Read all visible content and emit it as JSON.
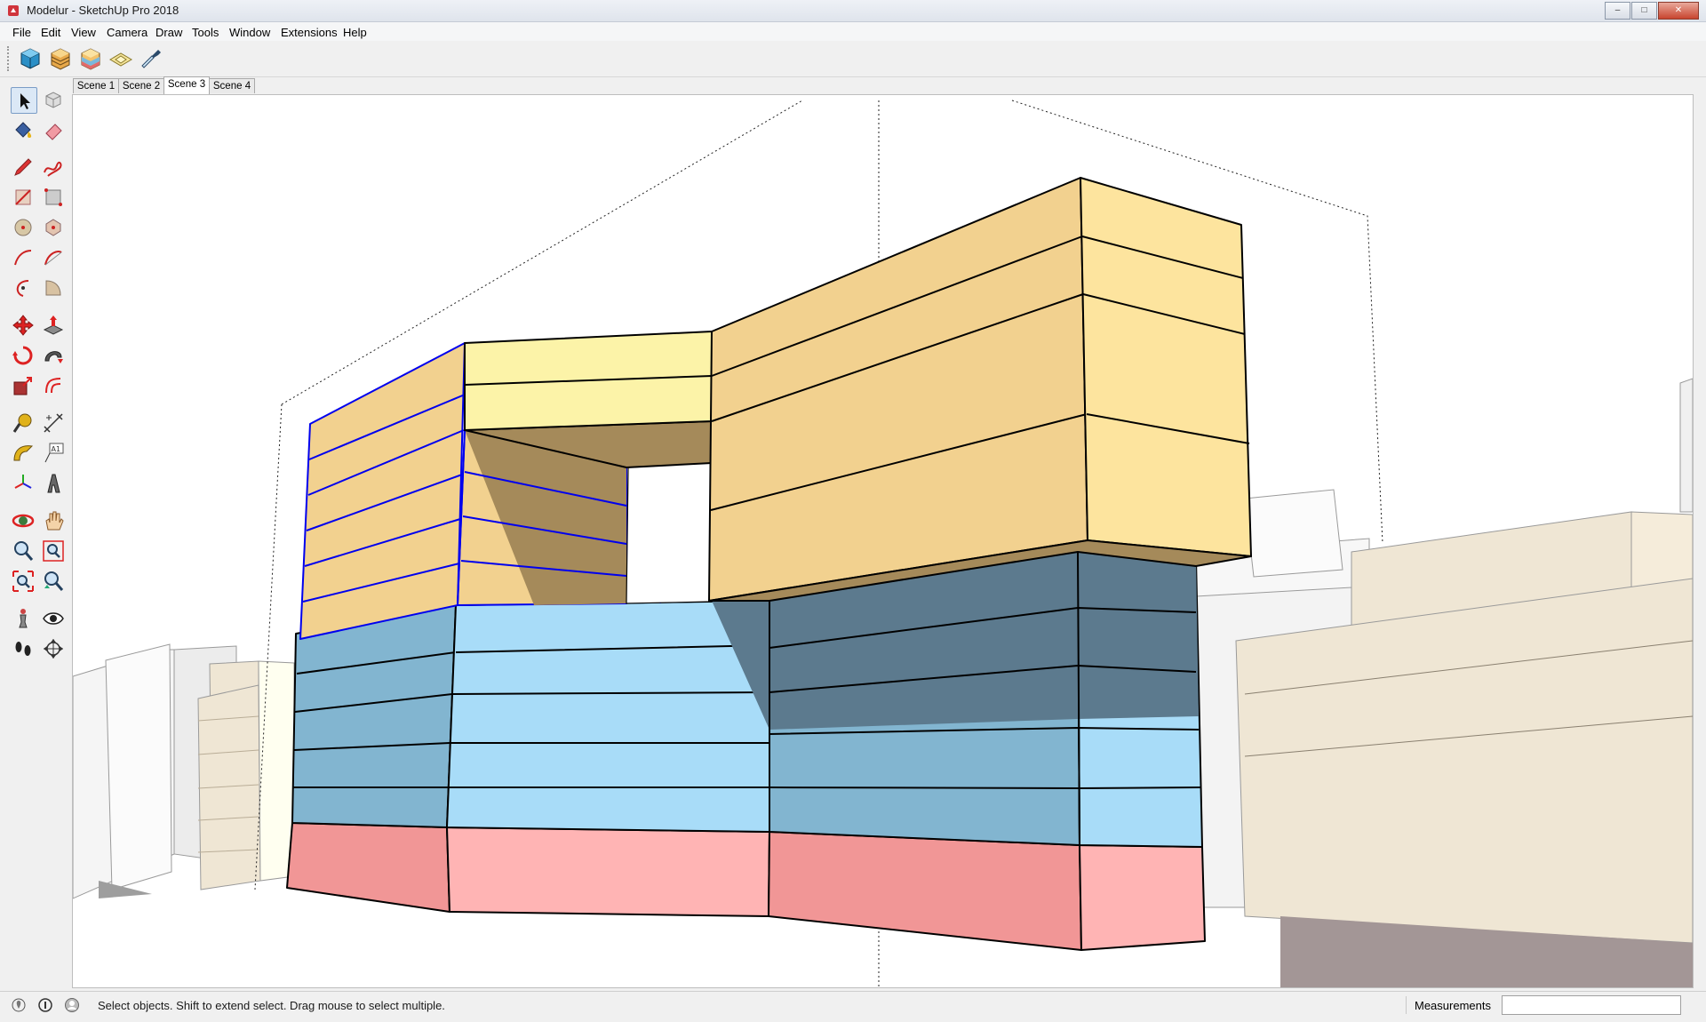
{
  "window": {
    "title": "Modelur - SketchUp Pro 2018",
    "minimize": "–",
    "maximize": "□",
    "close": "✕"
  },
  "menu": [
    {
      "label": "File",
      "name": "menu-file"
    },
    {
      "label": "Edit",
      "name": "menu-edit"
    },
    {
      "label": "View",
      "name": "menu-view"
    },
    {
      "label": "Camera",
      "name": "menu-camera"
    },
    {
      "label": "Draw",
      "name": "menu-draw"
    },
    {
      "label": "Tools",
      "name": "menu-tools"
    },
    {
      "label": "Window",
      "name": "menu-window"
    },
    {
      "label": "Extensions",
      "name": "menu-extensions"
    },
    {
      "label": "Help",
      "name": "menu-help"
    }
  ],
  "toolbar": {
    "icons": [
      "modelur-building-icon",
      "modelur-layers-icon",
      "modelur-stack-icon",
      "modelur-plot-icon",
      "eyedropper-icon"
    ]
  },
  "scenes": {
    "tabs": [
      "Scene 1",
      "Scene 2",
      "Scene 3",
      "Scene 4"
    ],
    "active": "Scene 3"
  },
  "tools": {
    "icons": [
      "select-icon",
      "component-icon",
      "paint-bucket-icon",
      "eraser-icon",
      "pencil-icon",
      "freehand-icon",
      "rectangle-icon",
      "rotated-rectangle-icon",
      "circle-icon",
      "polygon-icon",
      "arc-icon",
      "two-point-arc-icon",
      "three-point-arc-icon",
      "pie-icon",
      "move-icon",
      "push-pull-icon",
      "rotate-icon",
      "follow-me-icon",
      "scale-icon",
      "offset-icon",
      "tape-measure-icon",
      "dimension-icon",
      "protractor-icon",
      "text-icon",
      "axes-icon",
      "3d-text-icon",
      "orbit-icon",
      "pan-icon",
      "zoom-icon",
      "zoom-window-icon",
      "zoom-extents-icon",
      "previous-view-icon",
      "position-camera-icon",
      "look-around-icon",
      "walk-icon",
      "section-plane-icon"
    ]
  },
  "status": {
    "hint": "Select objects. Shift to extend select. Drag mouse to select multiple.",
    "measurements_label": "Measurements",
    "measurements_value": ""
  },
  "colors": {
    "floor_pink": "#f19696",
    "floor_pink_light": "#ffb4b4",
    "floor_blue_dark": "#82b5d0",
    "floor_blue_light": "#a8dcf8",
    "floor_blue_shadow": "#5c7a8e",
    "floor_orange": "#f2d18f",
    "floor_orange_light": "#fde49e",
    "floor_yellow": "#fcf3a8",
    "selection_blue": "#0000ee",
    "context_beige": "#efe6d4"
  }
}
